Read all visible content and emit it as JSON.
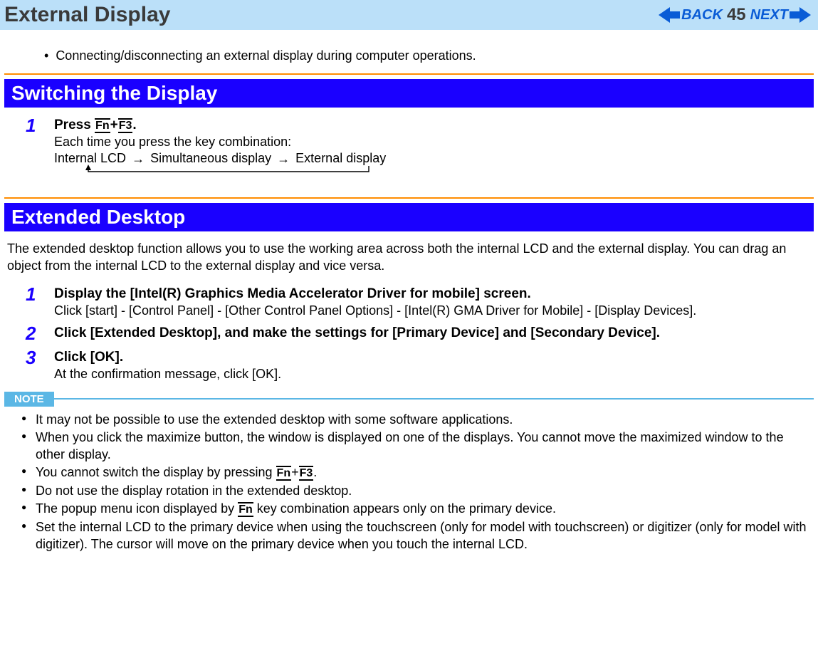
{
  "header": {
    "title": "External Display",
    "back_label": "BACK",
    "next_label": "NEXT",
    "page_number": "45"
  },
  "intro_bullet": "Connecting/disconnecting an external display during computer operations.",
  "section1": {
    "heading": "Switching the Display",
    "step1": {
      "num": "1",
      "title_prefix": "Press ",
      "key1": "Fn",
      "plus": "+",
      "key2": "F3",
      "title_suffix": ".",
      "sub": "Each time you press the key combination:",
      "cycle_a": "Internal LCD",
      "cycle_b": "Simultaneous display",
      "cycle_c": "External display"
    }
  },
  "section2": {
    "heading": "Extended Desktop",
    "para": "The extended desktop function allows you to use the working area across both the internal LCD and the external display. You can drag an object from the internal LCD to the external display and vice versa.",
    "step1": {
      "num": "1",
      "title": "Display the [Intel(R) Graphics Media Accelerator Driver for mobile] screen.",
      "sub": "Click [start] - [Control Panel] - [Other Control Panel Options] - [Intel(R) GMA Driver for Mobile] - [Display Devices]."
    },
    "step2": {
      "num": "2",
      "title": "Click [Extended Desktop], and make the settings for [Primary Device] and [Secondary Device]."
    },
    "step3": {
      "num": "3",
      "title": "Click [OK].",
      "sub": "At the confirmation message, click [OK]."
    }
  },
  "note": {
    "label": "NOTE",
    "items": {
      "n1": "It may not be possible to use the extended desktop with some software applications.",
      "n2": "When you click the maximize button, the window is displayed on one of the displays. You cannot move the maximized window to the other display.",
      "n3_pre": "You cannot switch the display by pressing ",
      "n3_k1": "Fn",
      "n3_plus": "+",
      "n3_k2": "F3",
      "n3_post": ".",
      "n4": "Do not use the display rotation in the extended desktop.",
      "n5_pre": "The popup menu icon displayed by ",
      "n5_k": "Fn",
      "n5_post": " key combination appears only on the primary device.",
      "n6": "Set the internal LCD to the primary device when using the touchscreen (only for model with touchscreen) or digitizer (only for model with digitizer). The cursor will move on the primary device when you touch the internal LCD."
    }
  }
}
